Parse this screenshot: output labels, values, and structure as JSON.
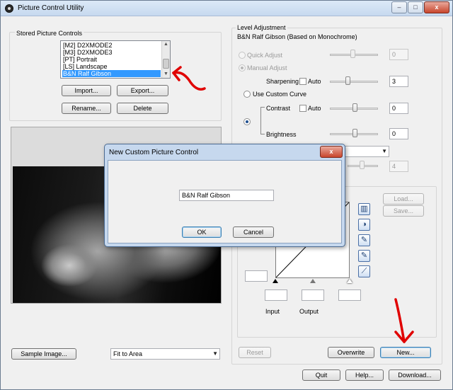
{
  "window": {
    "title": "Picture Control Utility",
    "minimize": "–",
    "maximize": "□",
    "close": "x"
  },
  "stored": {
    "group_label": "Stored Picture Controls",
    "items": [
      "[M2] D2XMODE2",
      "[M3] D2XMODE3",
      "[PT] Portrait",
      "[LS] Landscape",
      "B&N Ralf Gibson"
    ],
    "selected_index": 4,
    "import_label": "Import...",
    "export_label": "Export...",
    "rename_label": "Rename...",
    "delete_label": "Delete"
  },
  "preview": {
    "sample_image_label": "Sample Image...",
    "fit_select_value": "Fit to Area"
  },
  "level": {
    "group_label": "Level Adjustment",
    "picture_name": "B&N Ralf Gibson (Based on Monochrome)",
    "quick_adjust_label": "Quick Adjust",
    "quick_adjust_value": "0",
    "manual_adjust_label": "Manual Adjust",
    "sharpening_label": "Sharpening",
    "sharpening_auto_label": "Auto",
    "sharpening_value": "3",
    "custom_curve_label": "Use Custom Curve",
    "contrast_label": "Contrast",
    "contrast_auto_label": "Auto",
    "contrast_value": "0",
    "brightness_label": "Brightness",
    "brightness_value": "0",
    "hidden_value": "4"
  },
  "curve": {
    "load_label": "Load...",
    "save_label": "Save...",
    "input_label": "Input",
    "output_label": "Output"
  },
  "bottom": {
    "reset_label": "Reset",
    "overwrite_label": "Overwrite",
    "new_label": "New...",
    "quit_label": "Quit",
    "help_label": "Help...",
    "download_label": "Download..."
  },
  "dialog": {
    "title": "New Custom Picture Control",
    "name_value": "B&N Ralf Gibson",
    "ok_label": "OK",
    "cancel_label": "Cancel",
    "close": "x"
  },
  "colors": {
    "selection": "#3399ff",
    "annotation_red": "#e00000",
    "dialog_close": "#c8452c"
  }
}
